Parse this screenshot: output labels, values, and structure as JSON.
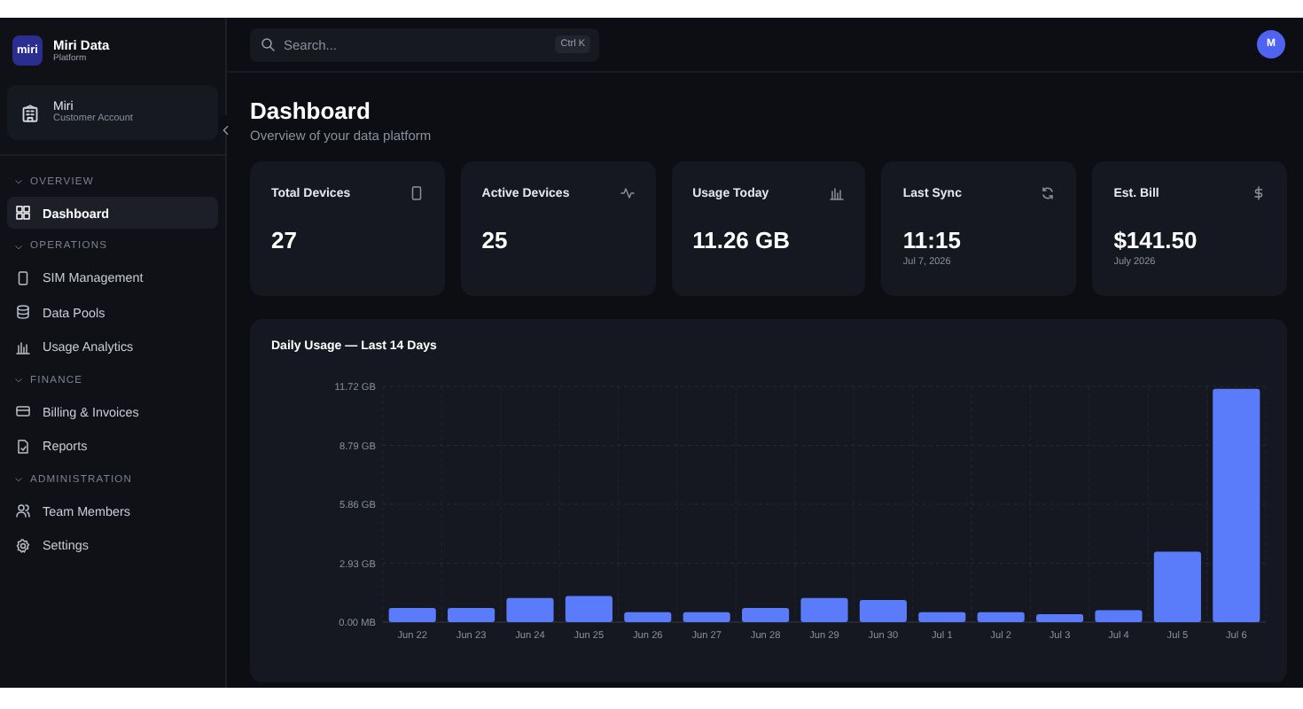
{
  "brand": {
    "logo": "miri",
    "name": "Miri Data",
    "subtitle": "Platform"
  },
  "account": {
    "name": "Miri",
    "type": "Customer Account"
  },
  "sidebar": {
    "sections": [
      {
        "label": "OVERVIEW",
        "expanded": true,
        "items": [
          {
            "label": "Dashboard",
            "kind": "grid",
            "selected": true
          }
        ]
      },
      {
        "label": "OPERATIONS",
        "expanded": true,
        "items": [
          {
            "label": "SIM Management",
            "kind": "phone",
            "selected": false
          },
          {
            "label": "Data Pools",
            "kind": "database",
            "selected": false
          },
          {
            "label": "Usage Analytics",
            "kind": "bars",
            "selected": false
          }
        ]
      },
      {
        "label": "FINANCE",
        "expanded": true,
        "items": [
          {
            "label": "Billing & Invoices",
            "kind": "card",
            "selected": false
          },
          {
            "label": "Reports",
            "kind": "file",
            "selected": false
          }
        ]
      },
      {
        "label": "ADMINISTRATION",
        "expanded": true,
        "items": [
          {
            "label": "Team Members",
            "kind": "users",
            "selected": false
          },
          {
            "label": "Settings",
            "kind": "gear",
            "selected": false
          }
        ]
      }
    ]
  },
  "search": {
    "placeholder": "Search...",
    "shortcut": "Ctrl K"
  },
  "user": {
    "initial": "M"
  },
  "page": {
    "title": "Dashboard",
    "subtitle": "Overview of your data platform"
  },
  "stats": [
    {
      "label": "Total Devices",
      "kind": "phone",
      "value": "27"
    },
    {
      "label": "Active Devices",
      "kind": "pulse",
      "value": "25"
    },
    {
      "label": "Usage Today",
      "kind": "bars",
      "value": "11.26 GB"
    },
    {
      "label": "Last Sync",
      "kind": "refresh",
      "value": "11:15",
      "note": "Jul 7, 2026"
    },
    {
      "label": "Est. Bill",
      "kind": "dollar",
      "value": "$141.50",
      "note": "July 2026"
    }
  ],
  "usage_chart": {
    "chart_data": {
      "type": "bar",
      "title": "Daily Usage — Last 14 Days",
      "categories": [
        "Jun 22",
        "Jun 23",
        "Jun 24",
        "Jun 25",
        "Jun 26",
        "Jun 27",
        "Jun 28",
        "Jun 29",
        "Jun 30",
        "Jul 1",
        "Jul 2",
        "Jul 3",
        "Jul 4",
        "Jul 5",
        "Jul 6"
      ],
      "series": [
        {
          "color": "#5b7cfa",
          "values": [
            0.7,
            0.7,
            1.2,
            1.3,
            0.5,
            0.5,
            0.7,
            1.2,
            1.1,
            0.5,
            0.5,
            0.4,
            0.6,
            3.5,
            11.6
          ]
        }
      ],
      "ylim": [
        0,
        11.72
      ],
      "grid": true,
      "yticks": [
        {
          "value": 0,
          "label": "0.00 MB"
        },
        {
          "value": 2.93,
          "label": "2.93 GB"
        },
        {
          "value": 5.86,
          "label": "5.86 GB"
        },
        {
          "value": 8.79,
          "label": "8.79 GB"
        },
        {
          "value": 11.72,
          "label": "11.72 GB"
        }
      ]
    }
  }
}
